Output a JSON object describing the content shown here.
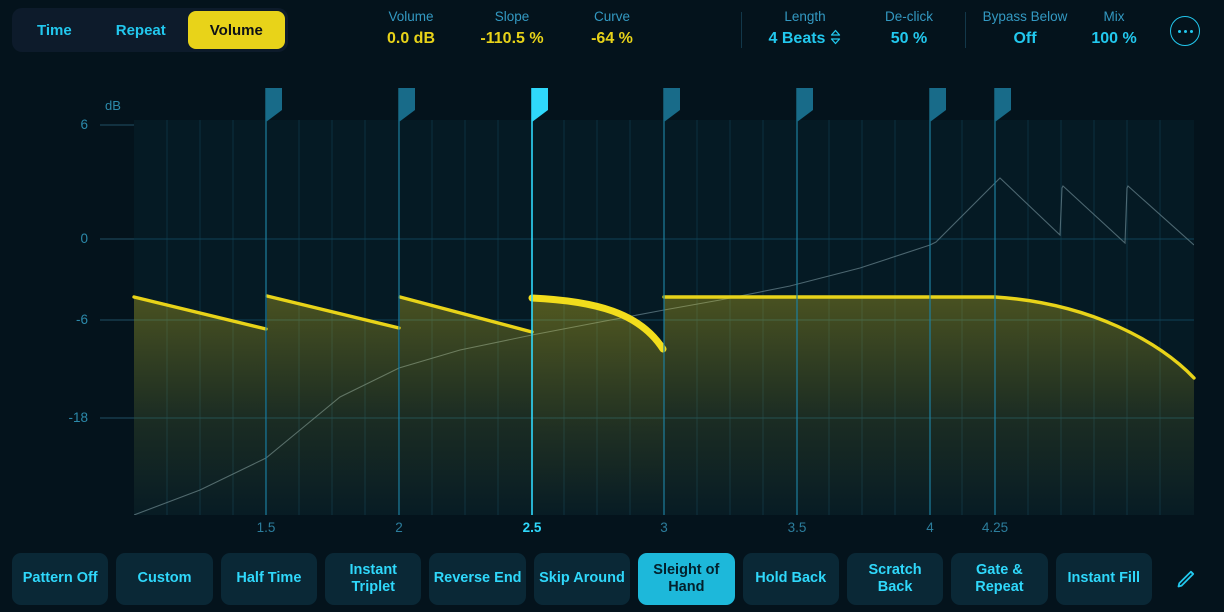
{
  "colors": {
    "background": "#04131c",
    "accent_cyan": "#22c8ee",
    "accent_yellow": "#e8d319",
    "panel": "#0a2836",
    "grid": "#0f4357"
  },
  "header": {
    "tabs": [
      {
        "label": "Time",
        "active": false
      },
      {
        "label": "Repeat",
        "active": false
      },
      {
        "label": "Volume",
        "active": true
      }
    ],
    "params": [
      {
        "name": "Volume",
        "value": "0.0 dB",
        "style": "yellow",
        "stepper": false
      },
      {
        "name": "Slope",
        "value": "-110.5 %",
        "style": "yellow",
        "stepper": false
      },
      {
        "name": "Curve",
        "value": "-64 %",
        "style": "yellow",
        "stepper": false
      },
      {
        "name": "Length",
        "value": "4 Beats",
        "style": "cyan",
        "stepper": true
      },
      {
        "name": "De-click",
        "value": "50 %",
        "style": "cyan",
        "stepper": false
      },
      {
        "name": "Bypass Below",
        "value": "Off",
        "style": "cyan",
        "stepper": false
      },
      {
        "name": "Mix",
        "value": "100 %",
        "style": "cyan",
        "stepper": false
      }
    ],
    "menu_icon": "ellipsis-circle-icon"
  },
  "graph": {
    "y_axis_unit": "dB",
    "y_ticks": [
      "6",
      "0",
      "-6",
      "-18"
    ],
    "x_ticks": [
      {
        "label": "1.5",
        "selected": false
      },
      {
        "label": "2",
        "selected": false
      },
      {
        "label": "2.5",
        "selected": true
      },
      {
        "label": "3",
        "selected": false
      },
      {
        "label": "3.5",
        "selected": false
      },
      {
        "label": "4",
        "selected": false
      },
      {
        "label": "4.25",
        "selected": false
      }
    ],
    "markers": [
      {
        "beat": "1.5",
        "selected": false
      },
      {
        "beat": "2",
        "selected": false
      },
      {
        "beat": "2.5",
        "selected": true
      },
      {
        "beat": "3",
        "selected": false
      },
      {
        "beat": "3.5",
        "selected": false
      },
      {
        "beat": "4",
        "selected": false
      },
      {
        "beat": "4.25",
        "selected": false
      }
    ]
  },
  "chart_data": {
    "type": "line",
    "title": "",
    "xlabel": "",
    "ylabel": "dB",
    "xlim": [
      1.0,
      4.6
    ],
    "ylim": [
      -24,
      6
    ],
    "grid": true,
    "legend": "none",
    "series": [
      {
        "name": "Volume envelope",
        "color": "#e8d319",
        "segments": [
          {
            "from_beat": 1.0,
            "to_beat": 1.5,
            "from_db": 0.0,
            "to_db": -2.2
          },
          {
            "from_beat": 1.5,
            "to_beat": 2.0,
            "from_db": 0.0,
            "to_db": -2.2
          },
          {
            "from_beat": 2.0,
            "to_beat": 2.5,
            "from_db": 0.0,
            "to_db": -2.4
          },
          {
            "from_beat": 2.5,
            "to_beat": 3.0,
            "from_db": 0.0,
            "to_db": -4.3,
            "curve": -64,
            "selected": true
          },
          {
            "from_beat": 3.0,
            "to_beat": 4.25,
            "from_db": 0.0,
            "to_db": 0.0
          },
          {
            "from_beat": 4.25,
            "to_beat": 4.6,
            "from_db": 0.0,
            "to_db": -6.0,
            "curve": -64
          }
        ]
      },
      {
        "name": "Time/pitch reference curve",
        "color": "#6f8a92",
        "description": "faint rising ramp with sawtooth resets in the right half"
      }
    ]
  },
  "footer": {
    "presets": [
      {
        "label": "Pattern Off",
        "active": false
      },
      {
        "label": "Custom",
        "active": false
      },
      {
        "label": "Half Time",
        "active": false
      },
      {
        "label": "Instant Triplet",
        "active": false
      },
      {
        "label": "Reverse End",
        "active": false
      },
      {
        "label": "Skip Around",
        "active": false
      },
      {
        "label": "Sleight of Hand",
        "active": true
      },
      {
        "label": "Hold Back",
        "active": false
      },
      {
        "label": "Scratch Back",
        "active": false
      },
      {
        "label": "Gate & Repeat",
        "active": false
      },
      {
        "label": "Instant Fill",
        "active": false
      }
    ],
    "edit_icon": "pencil-icon"
  }
}
